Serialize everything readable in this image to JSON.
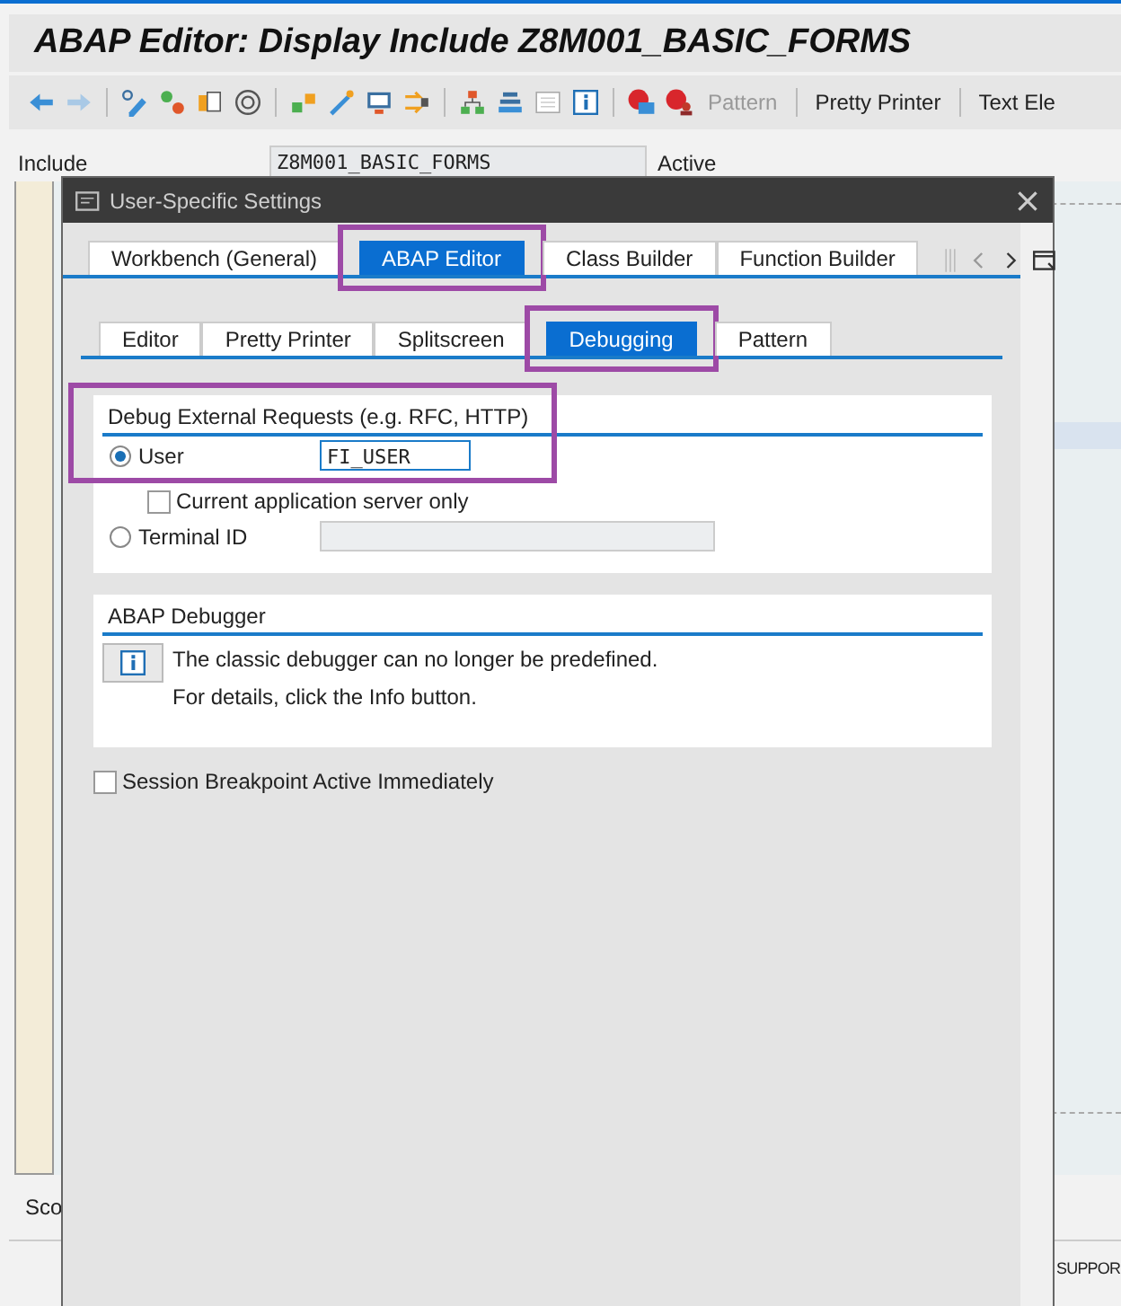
{
  "window": {
    "title": "ABAP Editor: Display Include Z8M001_BASIC_FORMS"
  },
  "toolbar": {
    "buttons": [
      {
        "label": "Pattern",
        "disabled": true
      },
      {
        "label": "Pretty Printer",
        "disabled": false
      },
      {
        "label": "Text Ele",
        "disabled": false
      }
    ]
  },
  "include_row": {
    "label": "Include",
    "value": "Z8M001_BASIC_FORMS",
    "status": "Active"
  },
  "editor": {
    "footer_left": "Sco",
    "footer_right": "SUPPOR"
  },
  "dialog": {
    "title": "User-Specific Settings",
    "tabs": [
      {
        "label": "Workbench (General)",
        "selected": false,
        "highlighted": false
      },
      {
        "label": "ABAP Editor",
        "selected": true,
        "highlighted": true
      },
      {
        "label": "Class Builder",
        "selected": false,
        "highlighted": false
      },
      {
        "label": "Function Builder",
        "selected": false,
        "highlighted": false
      }
    ],
    "subtabs": [
      {
        "label": "Editor",
        "selected": false,
        "highlighted": false
      },
      {
        "label": "Pretty Printer",
        "selected": false,
        "highlighted": false
      },
      {
        "label": "Splitscreen",
        "selected": false,
        "highlighted": false
      },
      {
        "label": "Debugging",
        "selected": true,
        "highlighted": true
      },
      {
        "label": "Pattern",
        "selected": false,
        "highlighted": false
      }
    ],
    "external_requests": {
      "title": "Debug External Requests (e.g. RFC, HTTP)",
      "highlighted": true,
      "options": [
        {
          "kind": "radio",
          "label": "User",
          "selected": true,
          "value": "FI_USER",
          "field_disabled": false
        },
        {
          "kind": "checkbox",
          "label": "Current application server only",
          "checked": false
        },
        {
          "kind": "radio",
          "label": "Terminal ID",
          "selected": false,
          "field_disabled": true
        }
      ]
    },
    "debugger": {
      "title": "ABAP Debugger",
      "messages": [
        "The classic debugger can no longer be predefined.",
        "For details, click the Info button."
      ]
    },
    "session_breakpoint": {
      "label": "Session Breakpoint Active Immediately",
      "checked": false
    }
  }
}
